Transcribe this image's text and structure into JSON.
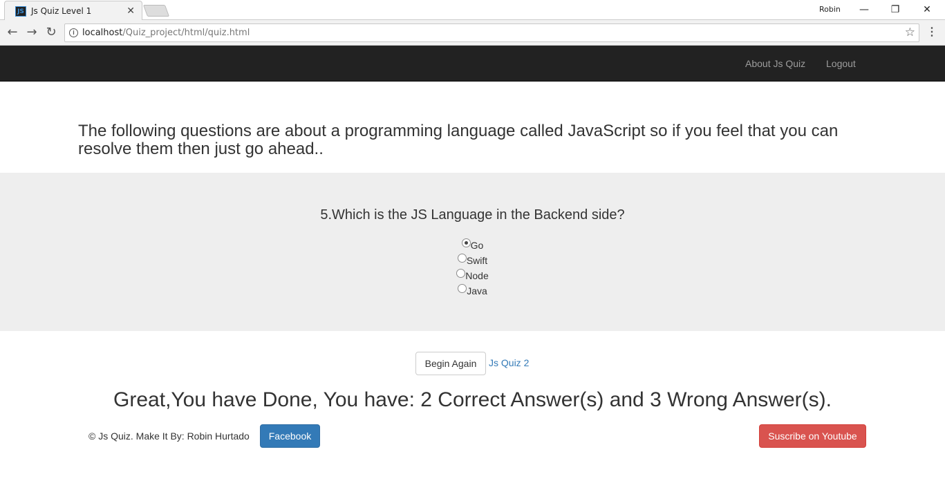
{
  "browser": {
    "tab_title": "Js Quiz Level 1",
    "favicon_text": "JS",
    "profile_name": "Robin",
    "url_host": "localhost",
    "url_path": "/Quiz_project/html/quiz.html"
  },
  "navbar": {
    "links": [
      {
        "label": "About Js Quiz"
      },
      {
        "label": "Logout"
      }
    ]
  },
  "intro_text": "The following questions are about a programming language called JavaScript so if you feel that you can resolve them then just go ahead..",
  "quiz": {
    "question": "5.Which is the JS Language in the Backend side?",
    "options": [
      {
        "label": "Go",
        "checked": true
      },
      {
        "label": "Swift",
        "checked": false
      },
      {
        "label": "Node",
        "checked": false
      },
      {
        "label": "Java",
        "checked": false
      }
    ]
  },
  "actions": {
    "begin_again_label": "Begin Again",
    "next_quiz_link": "Js Quiz 2"
  },
  "result_text": "Great,You have Done, You have: 2 Correct Answer(s) and 3 Wrong Answer(s).",
  "footer": {
    "credit_text": "© Js Quiz. Make It By: Robin Hurtado",
    "facebook_label": "Facebook",
    "youtube_label": "Suscribe on Youtube"
  },
  "icons": {
    "back": "back-arrow-icon",
    "forward": "forward-arrow-icon",
    "reload": "reload-icon",
    "info": "info-icon",
    "star": "star-icon",
    "menu": "kebab-menu-icon"
  },
  "colors": {
    "navbar_bg": "#222222",
    "jumbotron_bg": "#eeeeee",
    "primary": "#337ab7",
    "danger": "#d9534f"
  }
}
